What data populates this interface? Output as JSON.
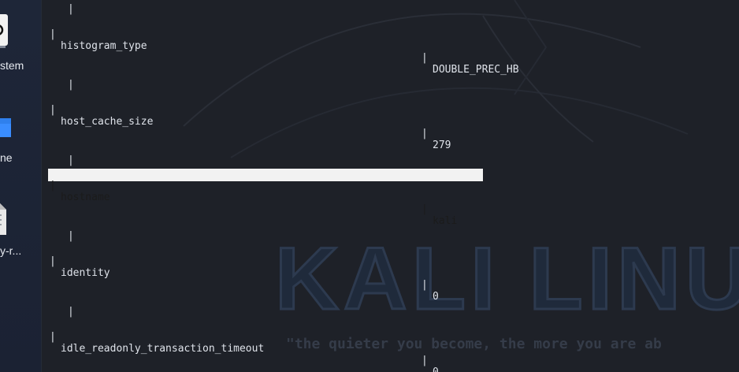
{
  "desktop": {
    "icons": [
      {
        "label": "stem",
        "icon": "system-icon"
      },
      {
        "label": "ne",
        "icon": "folder-icon"
      },
      {
        "label": "y-r...",
        "icon": "file-icon"
      }
    ]
  },
  "terminal": {
    "rows": [
      {
        "name": "histogram_type",
        "value": "DOUBLE_PREC_HB",
        "highlighted": false
      },
      {
        "name": "host_cache_size",
        "value": "279",
        "highlighted": false
      },
      {
        "name": "hostname",
        "value": "kali",
        "highlighted": true
      },
      {
        "name": "identity",
        "value": "0",
        "highlighted": false
      },
      {
        "name": "idle_readonly_transaction_timeout",
        "value": "0",
        "highlighted": false
      }
    ],
    "pipe": "|"
  },
  "wallpaper": {
    "brand": "KALI LINU",
    "tagline": "\"the quieter you become, the more you are ab"
  },
  "colors": {
    "terminal_bg": "#1e2128",
    "text": "#dfe3ea",
    "highlight_bg": "#f2f2f2"
  }
}
